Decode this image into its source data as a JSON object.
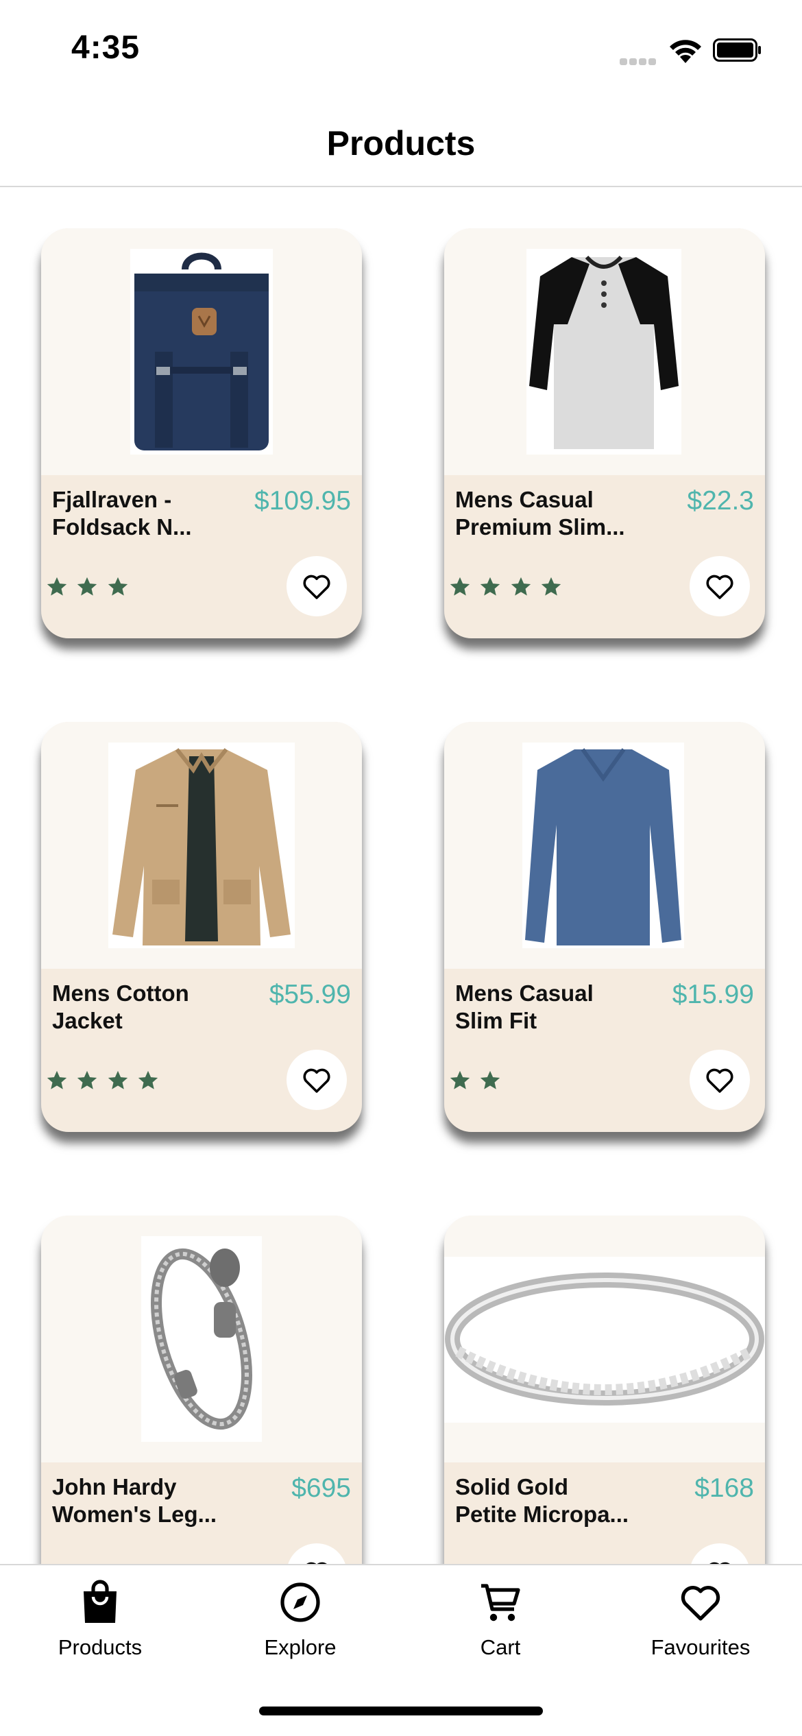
{
  "status_bar": {
    "time": "4:35"
  },
  "header": {
    "title": "Products"
  },
  "colors": {
    "price": "#4fb5ad",
    "star": "#3f6b4f",
    "card_bottom": "#f5ebdf",
    "card_top": "#faf7f2"
  },
  "products": [
    {
      "name": "Fjallraven - Foldsack N...",
      "price": "$109.95",
      "rating_stars": 3,
      "image": "navy-backpack"
    },
    {
      "name": "Mens Casual Premium Slim...",
      "price": "$22.3",
      "rating_stars": 4,
      "image": "raglan-henley-shirt"
    },
    {
      "name": "Mens Cotton Jacket",
      "price": "$55.99",
      "rating_stars": 4,
      "image": "tan-cotton-jacket"
    },
    {
      "name": "Mens Casual Slim Fit",
      "price": "$15.99",
      "rating_stars": 2,
      "image": "blue-long-sleeve-tee"
    },
    {
      "name": "John Hardy Women's Leg...",
      "price": "$695",
      "rating_stars": 0,
      "image": "silver-dragon-bracelet"
    },
    {
      "name": "Solid Gold Petite Micropa...",
      "price": "$168",
      "rating_stars": 0,
      "image": "silver-bangle-ring"
    }
  ],
  "tabs": [
    {
      "label": "Products",
      "icon": "shopping-bag-icon"
    },
    {
      "label": "Explore",
      "icon": "compass-icon"
    },
    {
      "label": "Cart",
      "icon": "cart-icon"
    },
    {
      "label": "Favourites",
      "icon": "heart-icon"
    }
  ]
}
